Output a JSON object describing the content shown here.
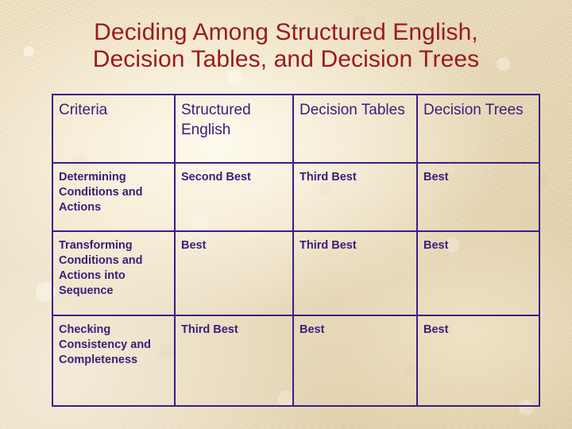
{
  "slide": {
    "title_lines": [
      "Deciding Among Structured English,",
      "Decision Tables, and Decision Trees"
    ],
    "colors": {
      "title_text": "#9a1b1b",
      "table_text": "#3a1d7a",
      "table_border": "#3a1d8a",
      "background": "#ecdfc2"
    }
  },
  "table": {
    "headers": [
      "Criteria",
      "Structured English",
      "Decision Tables",
      "Decision Trees"
    ],
    "rows": [
      {
        "criteria": "Determining Conditions and Actions",
        "structured_english": "Second Best",
        "decision_tables": "Third Best",
        "decision_trees": "Best"
      },
      {
        "criteria": "Transforming Conditions and Actions into Sequence",
        "structured_english": "Best",
        "decision_tables": "Third Best",
        "decision_trees": "Best"
      },
      {
        "criteria": "Checking Consistency and Completeness",
        "structured_english": "Third Best",
        "decision_tables": "Best",
        "decision_trees": "Best"
      }
    ]
  }
}
